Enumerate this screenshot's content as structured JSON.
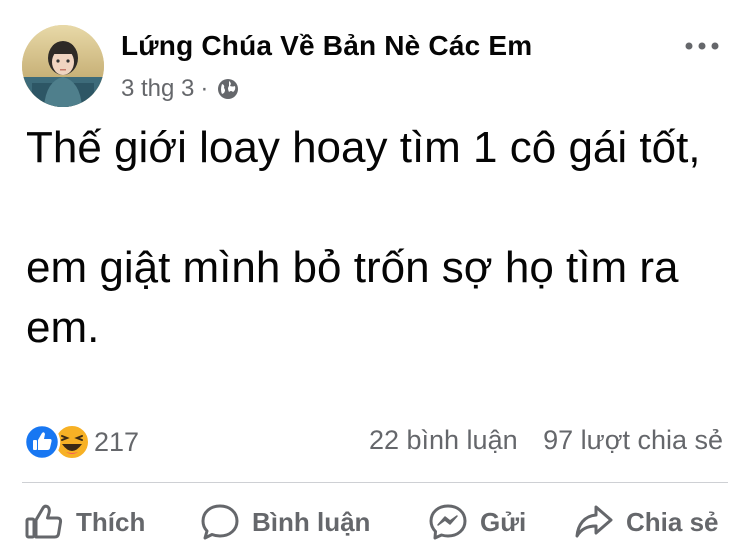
{
  "post": {
    "author": "Lứng Chúa Về Bản Nè Các Em",
    "date": "3 thg 3",
    "separator": "·",
    "privacy_icon": "globe-icon",
    "more_icon": "more-options-icon",
    "text_line_1": "Thế giới loay hoay tìm 1 cô gái tốt,",
    "text_line_2": "em giật mình bỏ trốn sợ họ tìm ra em."
  },
  "reactions": {
    "types": [
      "like",
      "haha"
    ],
    "count": "217",
    "comments": "22 bình luận",
    "shares": "97 lượt chia sẻ"
  },
  "actions": {
    "like_label": "Thích",
    "comment_label": "Bình luận",
    "send_label": "Gửi",
    "share_label": "Chia sẻ"
  },
  "colors": {
    "secondary_text": "#65676b",
    "like_blue": "#1877f2",
    "haha_yellow": "#f7b125",
    "divider": "#ced0d4"
  }
}
